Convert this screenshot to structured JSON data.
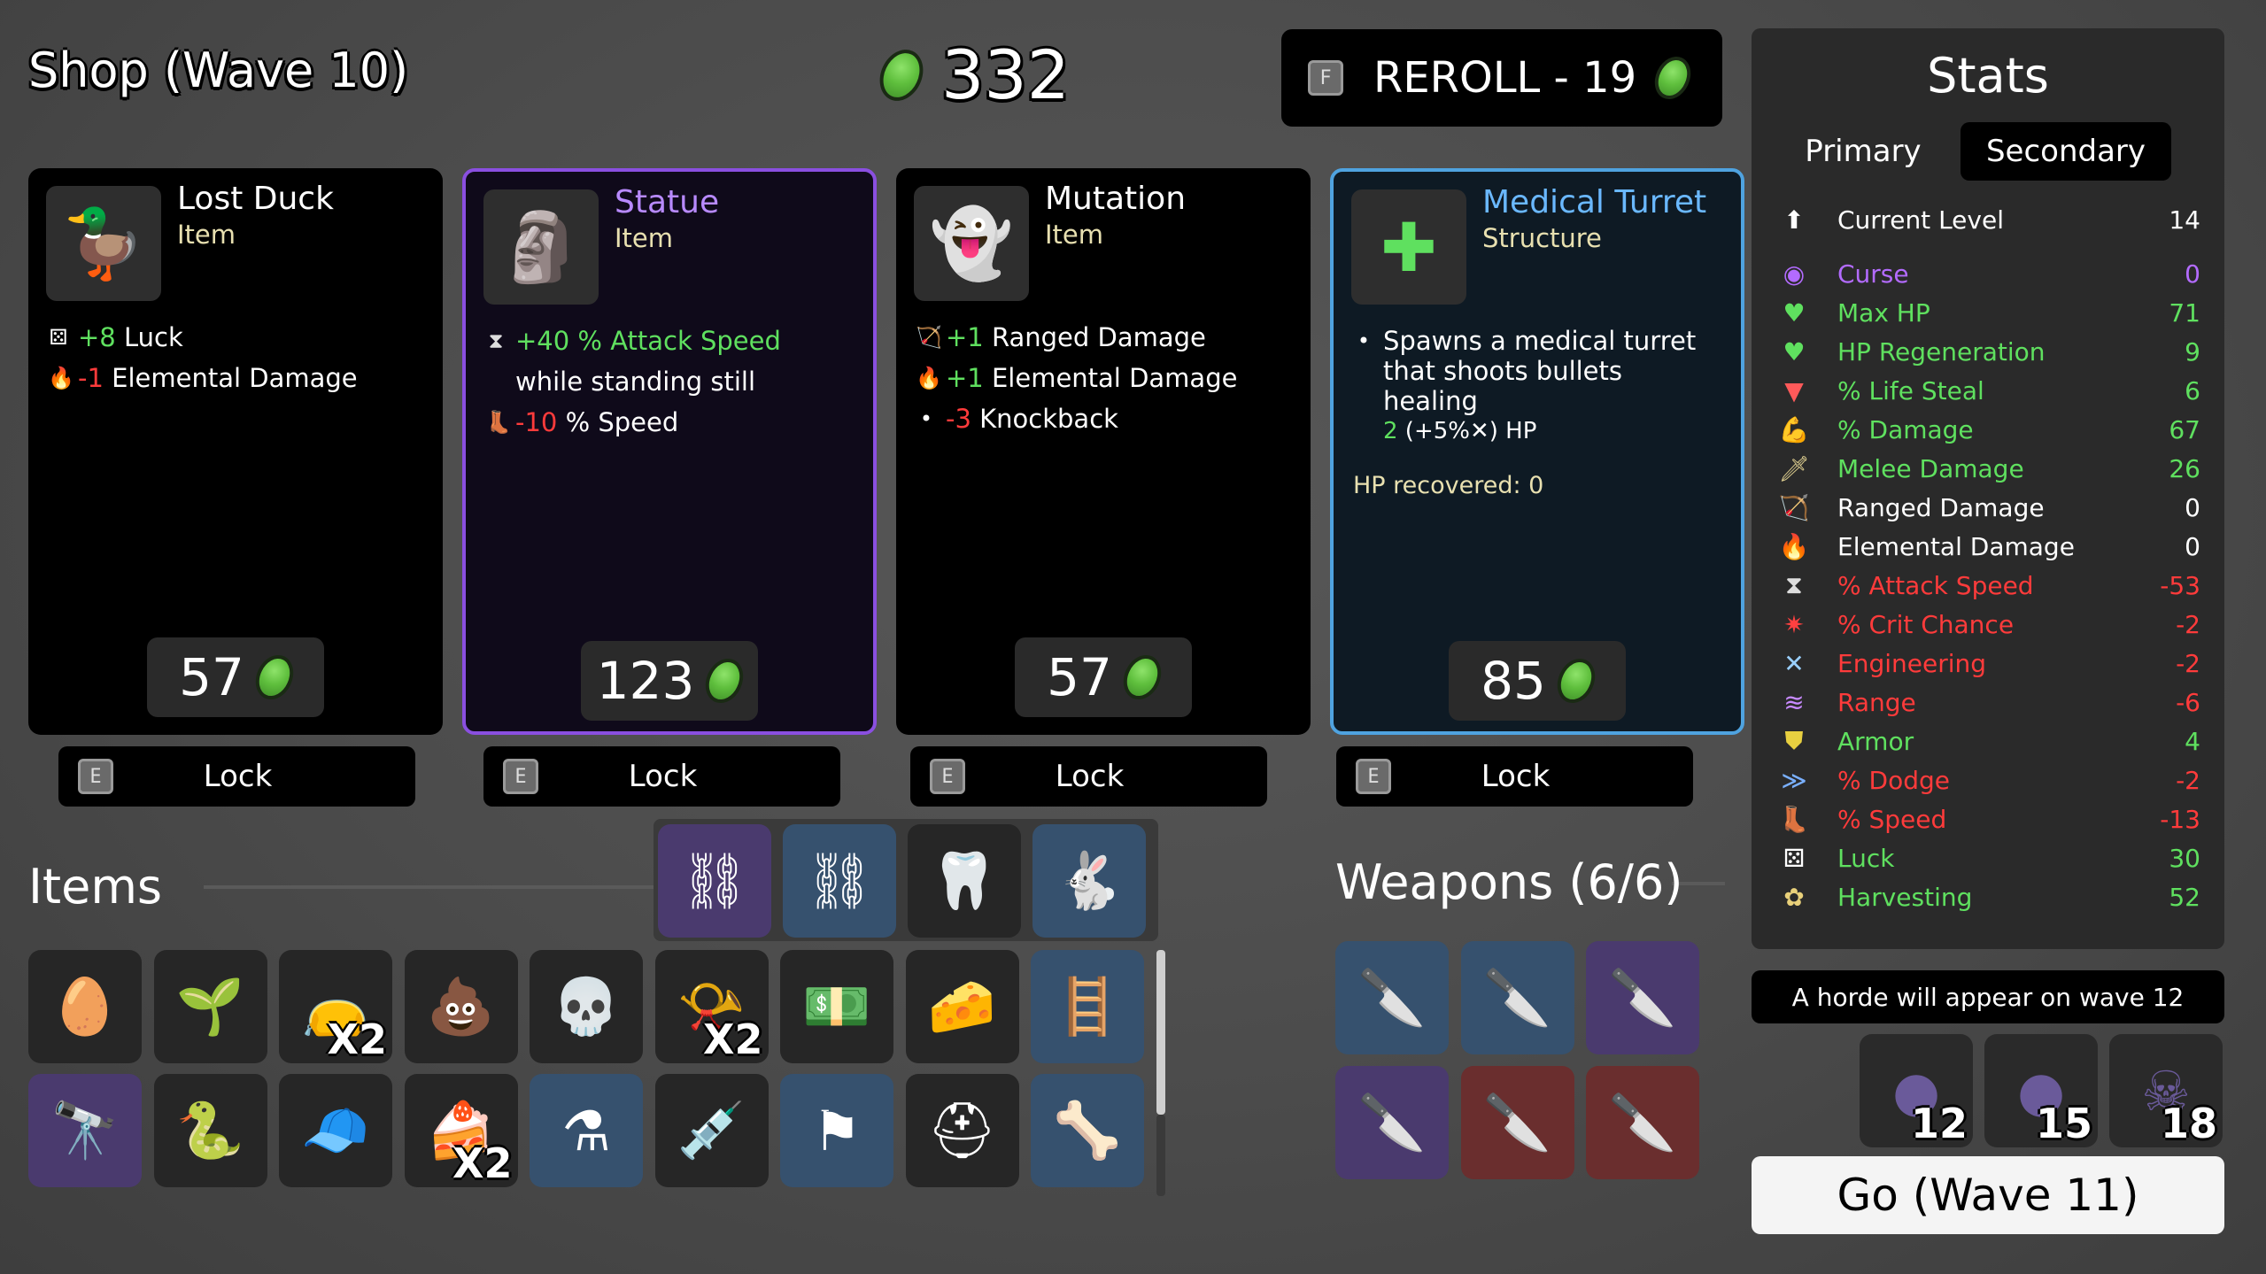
{
  "header": {
    "shop_title": "Shop (Wave 10)",
    "materials": "332",
    "reroll_key": "F",
    "reroll_label": "REROLL - 19"
  },
  "shop_cards": [
    {
      "name": "Lost Duck",
      "kind": "Item",
      "icon": "duck-icon",
      "price": "57",
      "border": "none",
      "stats": [
        {
          "icon": "dice-icon",
          "value": "+8",
          "text": " Luck",
          "value_color": "green"
        },
        {
          "icon": "flame-icon",
          "value": "-1",
          "text": " Elemental Damage",
          "value_color": "red"
        }
      ]
    },
    {
      "name": "Statue",
      "kind": "Item",
      "icon": "statue-icon",
      "price": "123",
      "border": "#8a4fe0",
      "stats": [
        {
          "icon": "hourglass-icon",
          "pre": "+40 % Attack Speed",
          "text": " while standing still"
        },
        {
          "icon": "boot-icon",
          "value": "-10",
          "text": " % Speed"
        }
      ]
    },
    {
      "name": "Mutation",
      "kind": "Item",
      "icon": "mutation-icon",
      "price": "57",
      "border": "none",
      "stats": [
        {
          "icon": "bow-icon",
          "value": "+1",
          "text": " Ranged Damage"
        },
        {
          "icon": "flame-icon",
          "value": "+1",
          "text": " Elemental Damage"
        },
        {
          "icon": "bullet-icon",
          "value": "-3",
          "text": " Knockback"
        }
      ]
    },
    {
      "name": "Medical Turret",
      "kind": "Structure",
      "icon": "medical-turret-icon",
      "price": "85",
      "border": "#4fa3e0",
      "desc_line1": "Spawns a medical turret",
      "desc_line2": "that shoots bullets healing",
      "desc_line3_value": "2",
      "desc_line3_rest": " (+5%✕) HP",
      "extra": "HP recovered: 0"
    }
  ],
  "lock": {
    "key": "E",
    "label": "Lock"
  },
  "items_title": "Items",
  "weapons_title": "Weapons (6/6)",
  "items_top_row": [
    {
      "icon": "flail-icon",
      "tier": "purple"
    },
    {
      "icon": "manacles-icon",
      "tier": "blue"
    },
    {
      "icon": "tooth-icon",
      "tier": "normal"
    },
    {
      "icon": "rabbit-icon",
      "tier": "blue"
    }
  ],
  "items_row1": [
    {
      "icon": "egg-icon",
      "tier": "normal"
    },
    {
      "icon": "sprout-icon",
      "tier": "normal"
    },
    {
      "icon": "moss-bag-icon",
      "tier": "normal",
      "qty": "X2"
    },
    {
      "icon": "poop-icon",
      "tier": "normal"
    },
    {
      "icon": "skull-icon",
      "tier": "normal"
    },
    {
      "icon": "horn-icon",
      "tier": "normal",
      "qty": "X2"
    },
    {
      "icon": "banknote-icon",
      "tier": "normal"
    },
    {
      "icon": "cheese-icon",
      "tier": "normal"
    },
    {
      "icon": "ladder-icon",
      "tier": "blue"
    }
  ],
  "items_row2": [
    {
      "icon": "cannon-icon",
      "tier": "purple"
    },
    {
      "icon": "worm-icon",
      "tier": "normal"
    },
    {
      "icon": "propeller-cap-icon",
      "tier": "normal"
    },
    {
      "icon": "cake-icon",
      "tier": "normal",
      "qty": "X2"
    },
    {
      "icon": "potion-icon",
      "tier": "blue"
    },
    {
      "icon": "syringe-icon",
      "tier": "normal"
    },
    {
      "icon": "flag-icon",
      "tier": "blue"
    },
    {
      "icon": "helmet-icon",
      "tier": "normal"
    },
    {
      "icon": "claw-icon",
      "tier": "blue"
    }
  ],
  "weapons": [
    {
      "icon": "cleaver-icon",
      "tier": "blue"
    },
    {
      "icon": "cleaver-icon",
      "tier": "blue"
    },
    {
      "icon": "cleaver-icon",
      "tier": "purple"
    },
    {
      "icon": "cleaver-icon",
      "tier": "purple"
    },
    {
      "icon": "cleaver-icon",
      "tier": "red"
    },
    {
      "icon": "cleaver-icon",
      "tier": "red"
    }
  ],
  "stats_panel": {
    "title": "Stats",
    "tab_primary": "Primary",
    "tab_secondary": "Secondary",
    "rows": [
      {
        "icon": "level-icon",
        "label": "Current Level",
        "value": "14",
        "color": "white"
      },
      {
        "icon": "curse-eye-icon",
        "label": "Curse",
        "value": "0",
        "color": "purple"
      },
      {
        "icon": "heart-icon",
        "label": "Max HP",
        "value": "71",
        "color": "green"
      },
      {
        "icon": "regen-heart-icon",
        "label": "HP Regeneration",
        "value": "9",
        "color": "green"
      },
      {
        "icon": "fangs-icon",
        "label": "% Life Steal",
        "value": "6",
        "color": "green"
      },
      {
        "icon": "muscle-icon",
        "label": "% Damage",
        "value": "67",
        "color": "green"
      },
      {
        "icon": "sword-icon",
        "label": "Melee Damage",
        "value": "26",
        "color": "green"
      },
      {
        "icon": "bow-icon",
        "label": "Ranged Damage",
        "value": "0",
        "color": "white"
      },
      {
        "icon": "flame-icon",
        "label": "Elemental Damage",
        "value": "0",
        "color": "white"
      },
      {
        "icon": "hourglass-icon",
        "label": "% Attack Speed",
        "value": "-53",
        "color": "red"
      },
      {
        "icon": "crit-icon",
        "label": "% Crit Chance",
        "value": "-2",
        "color": "red"
      },
      {
        "icon": "wrench-icon",
        "label": "Engineering",
        "value": "-2",
        "color": "red"
      },
      {
        "icon": "range-icon",
        "label": "Range",
        "value": "-6",
        "color": "red"
      },
      {
        "icon": "shield-icon",
        "label": "Armor",
        "value": "4",
        "color": "green"
      },
      {
        "icon": "dodge-icon",
        "label": "% Dodge",
        "value": "-2",
        "color": "red"
      },
      {
        "icon": "boot-icon",
        "label": "% Speed",
        "value": "-13",
        "color": "red"
      },
      {
        "icon": "dice-icon",
        "label": "Luck",
        "value": "30",
        "color": "green"
      },
      {
        "icon": "harvest-icon",
        "label": "Harvesting",
        "value": "52",
        "color": "green"
      }
    ]
  },
  "horde_notice": "A horde will appear on wave 12",
  "enemy_waves": [
    {
      "icon": "enemy-group-icon",
      "wave": "12"
    },
    {
      "icon": "enemy-group-icon",
      "wave": "15"
    },
    {
      "icon": "boss-icon",
      "wave": "18"
    }
  ],
  "go_button": "Go (Wave 11)"
}
